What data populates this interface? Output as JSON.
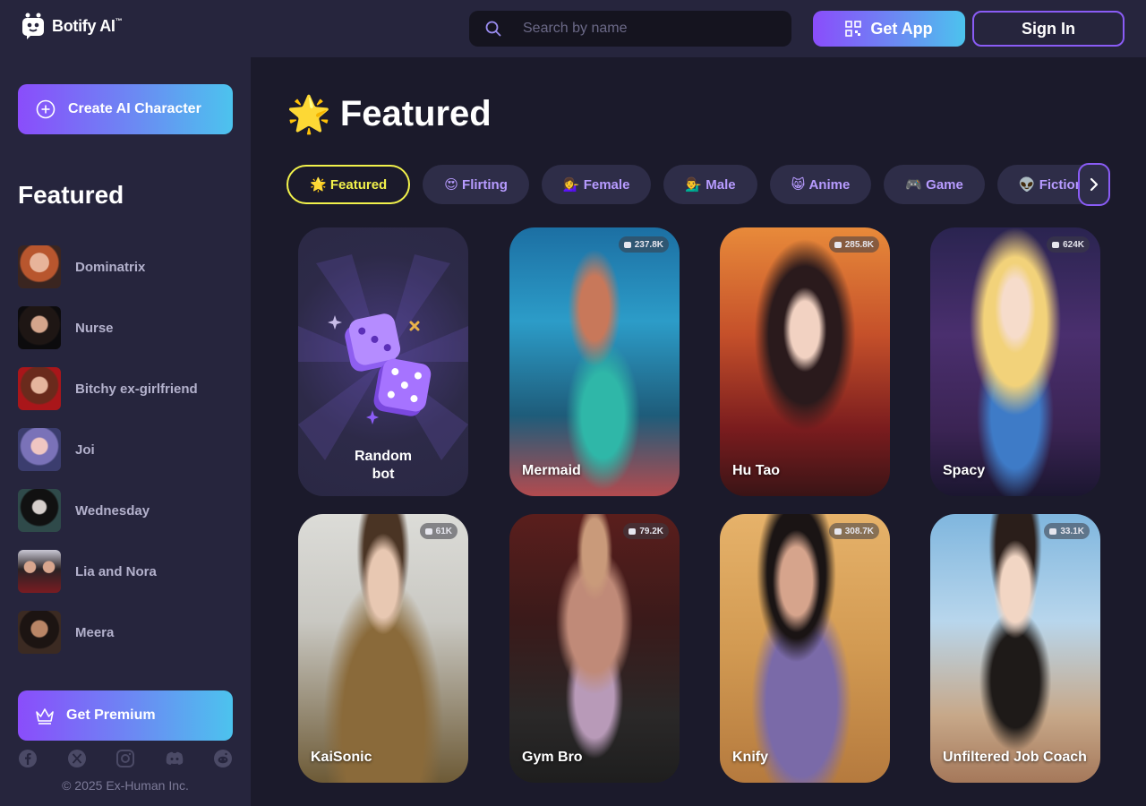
{
  "header": {
    "brand": "Botify AI",
    "brand_tm": "™",
    "search_placeholder": "Search by name",
    "get_app_label": "Get App",
    "sign_in_label": "Sign In"
  },
  "sidebar": {
    "create_label": "Create AI Character",
    "section_title": "Featured",
    "items": [
      {
        "label": "Dominatrix"
      },
      {
        "label": "Nurse"
      },
      {
        "label": "Bitchy ex-girlfriend"
      },
      {
        "label": "Joi"
      },
      {
        "label": "Wednesday"
      },
      {
        "label": "Lia and Nora"
      },
      {
        "label": "Meera"
      }
    ],
    "premium_label": "Get Premium",
    "socials": [
      "facebook-icon",
      "x-icon",
      "instagram-icon",
      "discord-icon",
      "reddit-icon"
    ],
    "copyright": "© 2025 Ex-Human Inc."
  },
  "main": {
    "title_emoji": "🌟",
    "title": "Featured",
    "chips": [
      {
        "emoji": "🌟",
        "label": "Featured"
      },
      {
        "emoji": "😍",
        "label": "Flirting"
      },
      {
        "emoji": "💁‍♀️",
        "label": "Female"
      },
      {
        "emoji": "💁‍♂️",
        "label": "Male"
      },
      {
        "emoji": "😸",
        "label": "Anime"
      },
      {
        "emoji": "🎮",
        "label": "Game"
      },
      {
        "emoji": "👽",
        "label": "Fiction"
      }
    ],
    "random_card": {
      "line1": "Random",
      "line2": "bot"
    },
    "cards": [
      {
        "name": "Mermaid",
        "count": "237.8K"
      },
      {
        "name": "Hu Tao",
        "count": "285.8K"
      },
      {
        "name": "Spacy",
        "count": "624K"
      },
      {
        "name": "KaiSonic",
        "count": "61K"
      },
      {
        "name": "Gym Bro",
        "count": "79.2K"
      },
      {
        "name": "Knify",
        "count": "308.7K"
      },
      {
        "name": "Unfiltered Job Coach",
        "count": "33.1K"
      }
    ]
  },
  "colors": {
    "accent_purple": "#8a4dfb",
    "accent_cyan": "#4cc3ee",
    "active_chip": "#f2f24b",
    "chip_text": "#b79bff"
  }
}
